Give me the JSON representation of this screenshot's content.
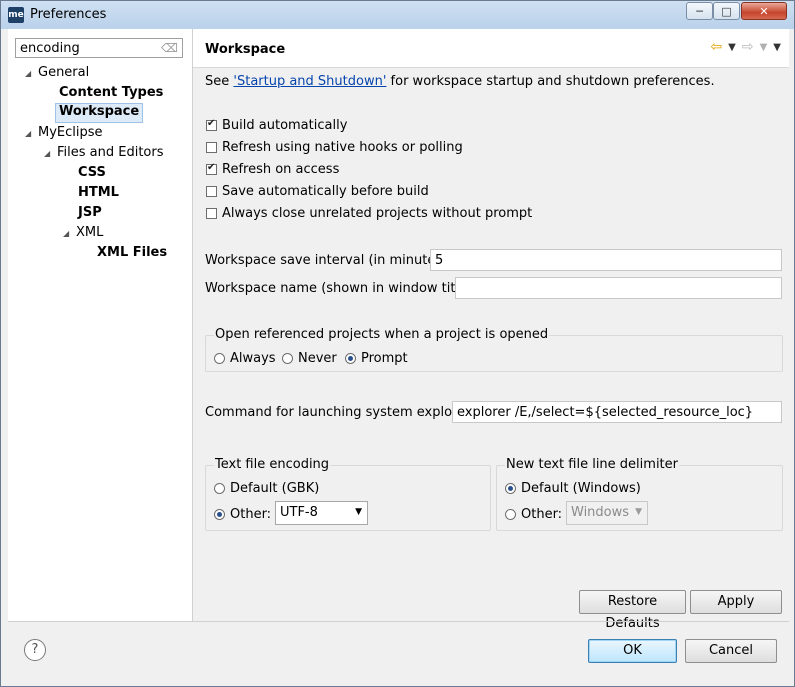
{
  "window": {
    "title": "Preferences",
    "app_icon": "me"
  },
  "filter": {
    "value": "encoding"
  },
  "tree": [
    {
      "label": "General",
      "level": 0,
      "expanded": true
    },
    {
      "label": "Content Types",
      "level": 1,
      "bold": true
    },
    {
      "label": "Workspace",
      "level": 1,
      "bold": true,
      "selected": true
    },
    {
      "label": "MyEclipse",
      "level": 0,
      "expanded": true
    },
    {
      "label": "Files and Editors",
      "level": 1,
      "expanded": true
    },
    {
      "label": "CSS",
      "level": 2,
      "bold": true
    },
    {
      "label": "HTML",
      "level": 2,
      "bold": true
    },
    {
      "label": "JSP",
      "level": 2,
      "bold": true
    },
    {
      "label": "XML",
      "level": 2,
      "expanded": true
    },
    {
      "label": "XML Files",
      "level": 3,
      "bold": true
    }
  ],
  "page": {
    "title": "Workspace",
    "intro_prefix": "See ",
    "intro_link": "'Startup and Shutdown'",
    "intro_suffix": " for workspace startup and shutdown preferences.",
    "checkboxes": [
      {
        "label": "Build automatically",
        "checked": true
      },
      {
        "label": "Refresh using native hooks or polling",
        "checked": false
      },
      {
        "label": "Refresh on access",
        "checked": true
      },
      {
        "label": "Save automatically before build",
        "checked": false
      },
      {
        "label": "Always close unrelated projects without prompt",
        "checked": false
      }
    ],
    "save_interval_label": "Workspace save interval (in minutes):",
    "save_interval_value": "5",
    "workspace_name_label": "Workspace name (shown in window title):",
    "workspace_name_value": "",
    "open_ref": {
      "title": "Open referenced projects when a project is opened",
      "options": [
        "Always",
        "Never",
        "Prompt"
      ],
      "selected": "Prompt"
    },
    "explorer_label": "Command for launching system explorer:",
    "explorer_value": "explorer /E,/select=${selected_resource_loc}",
    "encoding": {
      "title": "Text file encoding",
      "default_label": "Default (GBK)",
      "other_label": "Other:",
      "selected": "Other",
      "other_value": "UTF-8"
    },
    "delimiter": {
      "title": "New text file line delimiter",
      "default_label": "Default (Windows)",
      "other_label": "Other:",
      "selected": "Default",
      "other_value": "Windows"
    },
    "restore_label": "Restore Defaults",
    "apply_label": "Apply"
  },
  "footer": {
    "ok_label": "OK",
    "cancel_label": "Cancel"
  }
}
